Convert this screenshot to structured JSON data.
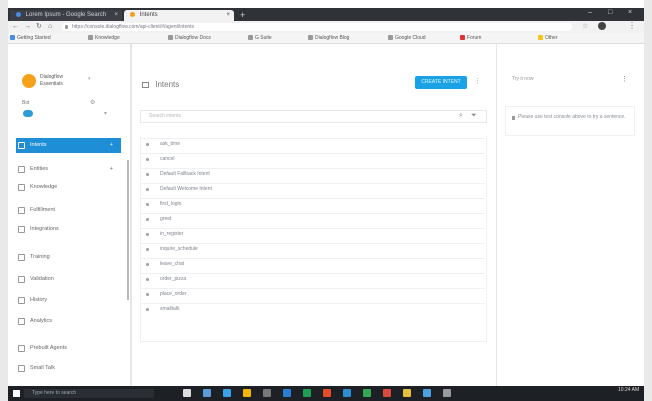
{
  "browser": {
    "tabs": [
      {
        "label": "Lorem Ipsum - Google Search",
        "state": "inactive"
      },
      {
        "label": "Intents",
        "state": "active"
      }
    ],
    "new_tab": "+",
    "address": "https://console.dialogflow.com/api-client/#/agent/intents",
    "bookmarks": [
      "Getting Started",
      "Knowledge",
      "Dialogflow Docs",
      "G Suite",
      "Dialogflow Blog",
      "Google Cloud",
      "Forum",
      "Other"
    ],
    "profile_label": "",
    "window_controls": [
      "–",
      "□",
      "×"
    ]
  },
  "sidebar": {
    "logo_text": "Dialogflow Essentials",
    "section_label": "Bot",
    "items": [
      {
        "label": "Intents",
        "icon": "chat-icon",
        "active": true,
        "arrow": "+"
      },
      {
        "label": "Entities",
        "icon": "entity-icon",
        "active": false,
        "arrow": "+"
      },
      {
        "label": "Knowledge",
        "icon": "book-icon",
        "active": false,
        "arrow": ""
      },
      {
        "label": "Fulfillment",
        "icon": "bolt-icon",
        "active": false,
        "arrow": ""
      },
      {
        "label": "Integrations",
        "icon": "puzzle-icon",
        "active": false,
        "arrow": ""
      },
      {
        "label": "Training",
        "icon": "graduation-icon",
        "active": false,
        "arrow": ""
      },
      {
        "label": "Validation",
        "icon": "check-icon",
        "active": false,
        "arrow": ""
      },
      {
        "label": "History",
        "icon": "clock-icon",
        "active": false,
        "arrow": ""
      },
      {
        "label": "Analytics",
        "icon": "chart-icon",
        "active": false,
        "arrow": ""
      },
      {
        "label": "Prebuilt Agents",
        "icon": "robot-icon",
        "active": false,
        "arrow": ""
      },
      {
        "label": "Small Talk",
        "icon": "bubble-icon",
        "active": false,
        "arrow": ""
      }
    ]
  },
  "main": {
    "title": "Intents",
    "create_button": "CREATE INTENT",
    "search_placeholder": "Search intents",
    "intents": [
      "ask_time",
      "cancel",
      "Default Fallback Intent",
      "Default Welcome Intent",
      "first_login",
      "greet",
      "in_register",
      "inquire_schedule",
      "leave_chat",
      "order_pizza",
      "place_order",
      "smalltalk"
    ]
  },
  "right_panel": {
    "title": "Try it now",
    "message": "Please use test console above to try a sentence."
  },
  "taskbar": {
    "search_placeholder": "Type here to search",
    "time": "10:24 AM"
  },
  "colors": {
    "accent": "#1e8fd6",
    "button": "#19a3e6",
    "logo": "#f7a11a"
  }
}
